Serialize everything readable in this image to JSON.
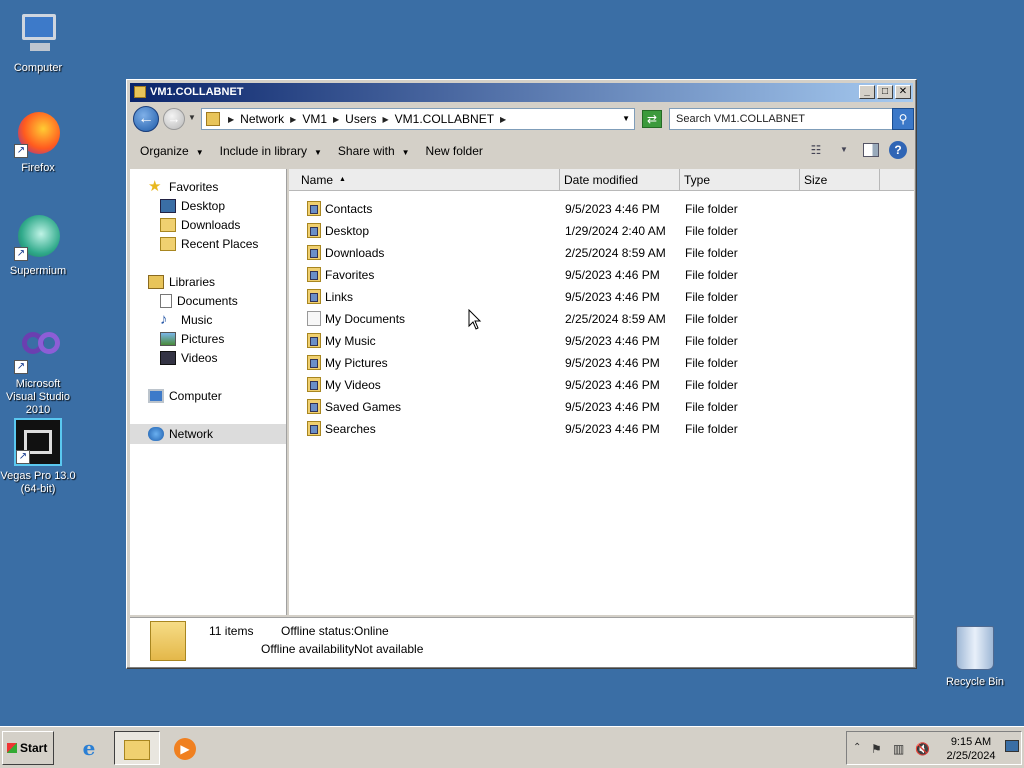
{
  "desktop": {
    "icons": [
      {
        "label": "Computer"
      },
      {
        "label": "Firefox"
      },
      {
        "label": "Supermium"
      },
      {
        "label": "Microsoft Visual Studio 2010"
      },
      {
        "label": "Vegas Pro 13.0 (64-bit)"
      }
    ],
    "recycle_bin": "Recycle Bin"
  },
  "window": {
    "title": "VM1.COLLABNET",
    "address": [
      "Network",
      "VM1",
      "Users",
      "VM1.COLLABNET"
    ],
    "search_placeholder": "Search VM1.COLLABNET"
  },
  "toolbar": {
    "organize": "Organize",
    "include": "Include in library",
    "share": "Share with",
    "newfolder": "New folder"
  },
  "nav": {
    "favorites": "Favorites",
    "desktop": "Desktop",
    "downloads": "Downloads",
    "recent": "Recent Places",
    "libraries": "Libraries",
    "documents": "Documents",
    "music": "Music",
    "pictures": "Pictures",
    "videos": "Videos",
    "computer": "Computer",
    "network": "Network"
  },
  "columns": {
    "name": "Name",
    "date": "Date modified",
    "type": "Type",
    "size": "Size"
  },
  "files": [
    {
      "name": "Contacts",
      "date": "9/5/2023 4:46 PM",
      "type": "File folder"
    },
    {
      "name": "Desktop",
      "date": "1/29/2024 2:40 AM",
      "type": "File folder"
    },
    {
      "name": "Downloads",
      "date": "2/25/2024 8:59 AM",
      "type": "File folder"
    },
    {
      "name": "Favorites",
      "date": "9/5/2023 4:46 PM",
      "type": "File folder"
    },
    {
      "name": "Links",
      "date": "9/5/2023 4:46 PM",
      "type": "File folder"
    },
    {
      "name": "My Documents",
      "date": "2/25/2024 8:59 AM",
      "type": "File folder"
    },
    {
      "name": "My Music",
      "date": "9/5/2023 4:46 PM",
      "type": "File folder"
    },
    {
      "name": "My Pictures",
      "date": "9/5/2023 4:46 PM",
      "type": "File folder"
    },
    {
      "name": "My Videos",
      "date": "9/5/2023 4:46 PM",
      "type": "File folder"
    },
    {
      "name": "Saved Games",
      "date": "9/5/2023 4:46 PM",
      "type": "File folder"
    },
    {
      "name": "Searches",
      "date": "9/5/2023 4:46 PM",
      "type": "File folder"
    }
  ],
  "details": {
    "count": "11 items",
    "status_label": "Offline status:",
    "status_value": "Online",
    "avail_label": "Offline availability:",
    "avail_value": "Not available"
  },
  "taskbar": {
    "start": "Start",
    "time": "9:15 AM",
    "date": "2/25/2024"
  }
}
